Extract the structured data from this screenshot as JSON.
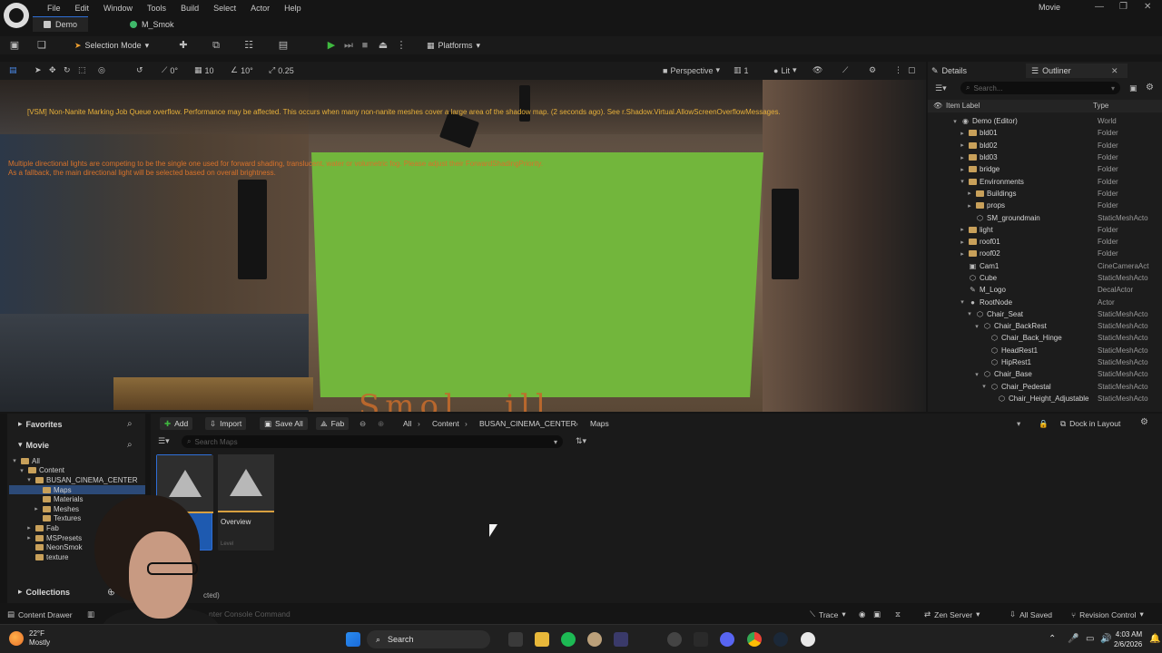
{
  "menubar": {
    "items": [
      "File",
      "Edit",
      "Window",
      "Tools",
      "Build",
      "Select",
      "Actor",
      "Help"
    ],
    "project_name": "Movie"
  },
  "tabs": [
    {
      "label": "Demo",
      "active": true
    },
    {
      "label": "M_Smok",
      "active": false
    }
  ],
  "toolbar": {
    "selection_mode_label": "Selection Mode",
    "platforms_label": "Platforms"
  },
  "viewport_toolbar": {
    "rotate_snap": "0°",
    "grid_snap": "10",
    "angle_snap": "10°",
    "scale_snap": "0.25",
    "view_mode_label": "Perspective",
    "camera_speed": "1",
    "lighting_label": "Lit"
  },
  "viewport": {
    "warning_vsm": "[VSM] Non-Nanite Marking Job Queue overflow. Performance may be affected. This occurs when many non-nanite meshes cover a large area of the shadow map. (2 seconds ago). See r.Shadow.Virtual.AllowScreenOverflowMessages.",
    "warning_lights_line1": "Multiple directional lights are competing to be the single one used for forward shading, translucent, water or volumetric fog. Please adjust their ForwardShadingPriority.",
    "warning_lights_line2": "As a fallback, the main directional light will be selected based on overall brightness.",
    "sign_text": "Smol...ill"
  },
  "right_panel": {
    "tab_details": "Details",
    "tab_outliner": "Outliner",
    "search_placeholder": "Search...",
    "col_item_label": "Item Label",
    "col_type": "Type",
    "tree": [
      {
        "label": "Demo (Editor)",
        "type": "World",
        "depth": 0,
        "icon": "world",
        "expanded": true
      },
      {
        "label": "bld01",
        "type": "Folder",
        "depth": 1,
        "icon": "folder",
        "expanded": false
      },
      {
        "label": "bld02",
        "type": "Folder",
        "depth": 1,
        "icon": "folder",
        "expanded": false
      },
      {
        "label": "bld03",
        "type": "Folder",
        "depth": 1,
        "icon": "folder",
        "expanded": false
      },
      {
        "label": "bridge",
        "type": "Folder",
        "depth": 1,
        "icon": "folder",
        "expanded": false
      },
      {
        "label": "Environments",
        "type": "Folder",
        "depth": 1,
        "icon": "folder",
        "expanded": true
      },
      {
        "label": "Buildings",
        "type": "Folder",
        "depth": 2,
        "icon": "folder",
        "expanded": false
      },
      {
        "label": "props",
        "type": "Folder",
        "depth": 2,
        "icon": "folder",
        "expanded": false
      },
      {
        "label": "SM_groundmain",
        "type": "StaticMeshActo",
        "depth": 2,
        "icon": "mesh",
        "expanded": null
      },
      {
        "label": "light",
        "type": "Folder",
        "depth": 1,
        "icon": "folder",
        "expanded": false
      },
      {
        "label": "roof01",
        "type": "Folder",
        "depth": 1,
        "icon": "folder",
        "expanded": false
      },
      {
        "label": "roof02",
        "type": "Folder",
        "depth": 1,
        "icon": "folder",
        "expanded": false
      },
      {
        "label": "Cam1",
        "type": "CineCameraAct",
        "depth": 1,
        "icon": "camera",
        "expanded": null
      },
      {
        "label": "Cube",
        "type": "StaticMeshActo",
        "depth": 1,
        "icon": "mesh",
        "expanded": null
      },
      {
        "label": "M_Logo",
        "type": "DecalActor",
        "depth": 1,
        "icon": "decal",
        "expanded": null
      },
      {
        "label": "RootNode",
        "type": "Actor",
        "depth": 1,
        "icon": "actor",
        "expanded": true
      },
      {
        "label": "Chair_Seat",
        "type": "StaticMeshActo",
        "depth": 2,
        "icon": "mesh",
        "expanded": true
      },
      {
        "label": "Chair_BackRest",
        "type": "StaticMeshActo",
        "depth": 3,
        "icon": "mesh",
        "expanded": true
      },
      {
        "label": "Chair_Back_Hinge",
        "type": "StaticMeshActo",
        "depth": 4,
        "icon": "mesh",
        "expanded": null
      },
      {
        "label": "HeadRest1",
        "type": "StaticMeshActo",
        "depth": 4,
        "icon": "mesh",
        "expanded": null
      },
      {
        "label": "HipRest1",
        "type": "StaticMeshActo",
        "depth": 4,
        "icon": "mesh",
        "expanded": null
      },
      {
        "label": "Chair_Base",
        "type": "StaticMeshActo",
        "depth": 3,
        "icon": "mesh",
        "expanded": true
      },
      {
        "label": "Chair_Pedestal",
        "type": "StaticMeshActo",
        "depth": 4,
        "icon": "mesh",
        "expanded": true
      },
      {
        "label": "Chair_Height_Adjustable",
        "type": "StaticMeshActo",
        "depth": 5,
        "icon": "mesh",
        "expanded": null
      }
    ]
  },
  "content_browser": {
    "favorites_label": "Favorites",
    "project_label": "Movie",
    "collections_label": "Collections",
    "add_label": "Add",
    "import_label": "Import",
    "save_all_label": "Save All",
    "fab_label": "Fab",
    "breadcrumbs": [
      "All",
      "Content",
      "BUSAN_CINEMA_CENTER",
      "Maps"
    ],
    "search_placeholder": "Search Maps",
    "dock_label": "Dock in Layout",
    "folders": [
      {
        "label": "All",
        "depth": 0,
        "selected": false,
        "arrow": "open"
      },
      {
        "label": "Content",
        "depth": 1,
        "selected": false,
        "arrow": "open"
      },
      {
        "label": "BUSAN_CINEMA_CENTER",
        "depth": 2,
        "selected": false,
        "arrow": "open"
      },
      {
        "label": "Maps",
        "depth": 3,
        "selected": true,
        "arrow": ""
      },
      {
        "label": "Materials",
        "depth": 3,
        "selected": false,
        "arrow": ""
      },
      {
        "label": "Meshes",
        "depth": 3,
        "selected": false,
        "arrow": "closed"
      },
      {
        "label": "Textures",
        "depth": 3,
        "selected": false,
        "arrow": ""
      },
      {
        "label": "Fab",
        "depth": 2,
        "selected": false,
        "arrow": "closed"
      },
      {
        "label": "MSPresets",
        "depth": 2,
        "selected": false,
        "arrow": "closed"
      },
      {
        "label": "NeonSmok",
        "depth": 2,
        "selected": false,
        "arrow": ""
      },
      {
        "label": "texture",
        "depth": 2,
        "selected": false,
        "arrow": ""
      }
    ],
    "assets": [
      {
        "name": "",
        "subtype": "",
        "selected": true
      },
      {
        "name": "Overview",
        "subtype": "Level",
        "selected": false
      }
    ],
    "selection_status": "cted)"
  },
  "statusbar": {
    "content_drawer": "Content Drawer",
    "console_placeholder": "nter Console Command",
    "trace_label": "Trace",
    "zen_server_label": "Zen Server",
    "all_saved_label": "All Saved",
    "revision_control_label": "Revision Control"
  },
  "taskbar": {
    "weather_temp": "22°F",
    "weather_desc": "Mostly",
    "search_label": "Search",
    "time": "4:03 AM",
    "date": "2/6/2026"
  },
  "colors": {
    "accent": "#2f6fd8",
    "green_screen": "#72b63c",
    "warning_yellow": "#e8b13a",
    "warning_orange": "#d8722a",
    "folder": "#c8a05a"
  }
}
